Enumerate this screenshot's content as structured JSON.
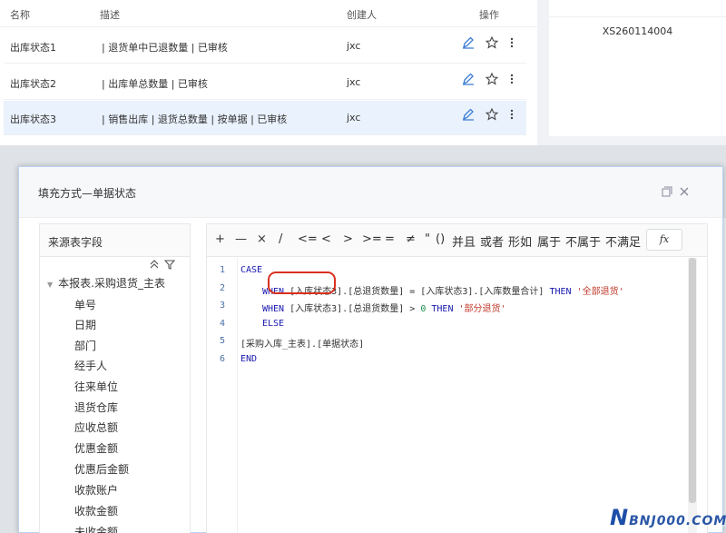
{
  "table": {
    "headers": {
      "name": "名称",
      "desc": "描述",
      "creator": "创建人",
      "action": "操作"
    },
    "rows": [
      {
        "name": "出库状态1",
        "desc": "| 退货单中已退数量 | 已审核",
        "creator": "jxc"
      },
      {
        "name": "出库状态2",
        "desc": "| 出库单总数量 | 已审核",
        "creator": "jxc"
      },
      {
        "name": "出库状态3",
        "desc": "| 销售出库 | 退货总数量 | 按单据 | 已审核",
        "creator": "jxc"
      }
    ]
  },
  "right_panel": {
    "value": "XS260114004"
  },
  "modal": {
    "title": "填充方式—单据状态",
    "left_panel": {
      "title": "来源表字段",
      "root": "本报表.采购退货_主表",
      "fields": [
        "单号",
        "日期",
        "部门",
        "经手人",
        "往来单位",
        "退货仓库",
        "应收总额",
        "优惠金额",
        "优惠后金额",
        "收款账户",
        "收款金额",
        "未收金额"
      ]
    },
    "toolbar": [
      "+",
      "—",
      "×",
      "/",
      "<=",
      "<",
      ">",
      ">=",
      "=",
      "≠",
      "\"",
      "()",
      "并且",
      "或者",
      "形如",
      "属于",
      "不属于",
      "不满足"
    ],
    "fx_label": "fx",
    "code": {
      "line_numbers": [
        "1",
        "2",
        "3",
        "4",
        "5",
        "6"
      ],
      "line1": "CASE",
      "line2_kw": "WHEN",
      "line2_mid": "[入库状态3].[总退货数量] = [入库状态3].[入库数量合计]",
      "line2_then": "THEN",
      "line2_str": "'全部退货'",
      "line3_kw": "WHEN",
      "line3_mid": "[入库状态3].[总退货数量] >",
      "line3_num": "0",
      "line3_then": "THEN",
      "line3_str": "'部分退货'",
      "line4": "ELSE",
      "line5": "[采购入库_主表].[单据状态]",
      "line6": "END"
    }
  },
  "watermark": {
    "big": "N",
    "rest": "BNJ000.COM"
  }
}
